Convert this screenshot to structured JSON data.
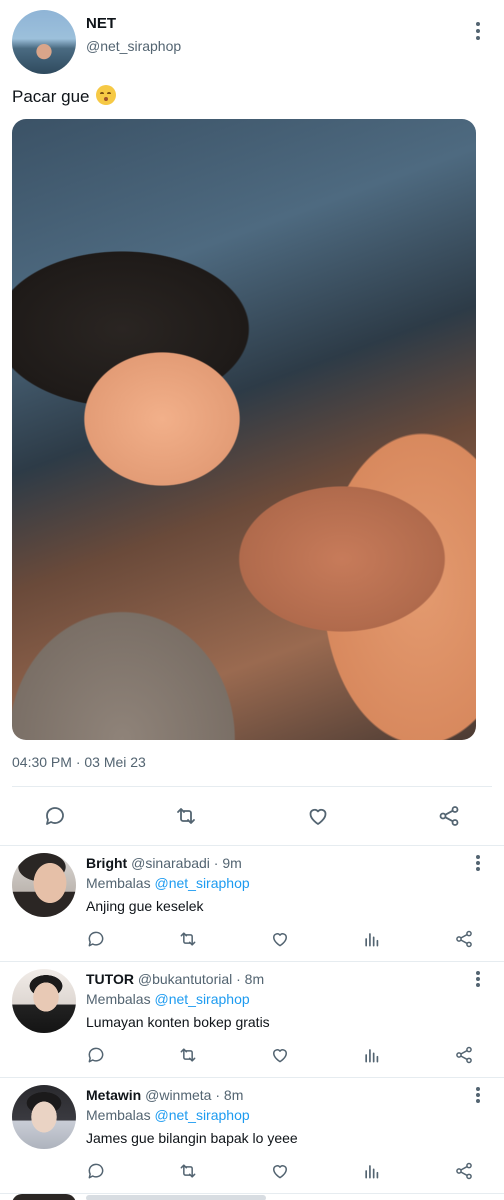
{
  "main_tweet": {
    "author_name": "NET",
    "author_handle": "@net_siraphop",
    "text": "Pacar gue",
    "emoji": "kissing-face-with-closed-eyes",
    "timestamp": "04:30 PM · 03 Mei 23"
  },
  "replies": [
    {
      "name": "Bright",
      "handle": "@sinarabadi · 9m",
      "replying_prefix": "Membalas",
      "replying_to": "@net_siraphop",
      "text": "Anjing gue keselek"
    },
    {
      "name": "TUTOR",
      "handle": "@bukantutorial · 8m",
      "replying_prefix": "Membalas",
      "replying_to": "@net_siraphop",
      "text": "Lumayan konten bokep gratis"
    },
    {
      "name": "Metawin",
      "handle": "@winmeta · 8m",
      "replying_prefix": "Membalas",
      "replying_to": "@net_siraphop",
      "text": "James gue bilangin bapak lo yeee"
    }
  ],
  "icons": {
    "reply": "speech-bubble-icon",
    "retweet": "retweet-icon",
    "like": "heart-icon",
    "share": "share-icon",
    "views": "bar-chart-icon",
    "more": "vertical-dots-icon"
  },
  "colors": {
    "accent": "#1d9bf0",
    "secondary_text": "#536471",
    "icon": "#536471",
    "divider": "#e6ecf0"
  }
}
